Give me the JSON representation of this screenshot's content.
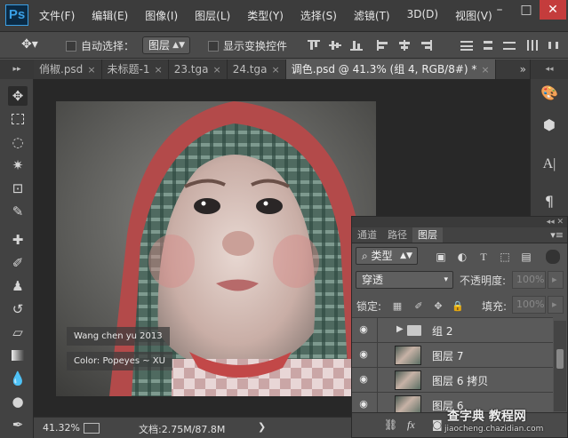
{
  "app": {
    "logo": "Ps"
  },
  "menu": [
    "文件(F)",
    "编辑(E)",
    "图像(I)",
    "图层(L)",
    "类型(Y)",
    "选择(S)",
    "滤镜(T)",
    "3D(D)",
    "视图(V)"
  ],
  "window_controls": [
    "–",
    "□",
    "✕"
  ],
  "options": {
    "auto_select_label": "自动选择：",
    "auto_select_value": "图层",
    "show_transform_label": "显示变换控件"
  },
  "tabs": [
    {
      "label": "俏椒.psd",
      "close": "×",
      "active": false
    },
    {
      "label": "未标题-1",
      "close": "×",
      "active": false
    },
    {
      "label": "23.tga",
      "close": "×",
      "active": false
    },
    {
      "label": "24.tga",
      "close": "×",
      "active": false
    },
    {
      "label": "调色.psd @ 41.3% (组 4, RGB/8#) *",
      "close": "×",
      "active": true
    }
  ],
  "tabs_more": "»",
  "canvas": {
    "watermark_line1": "Wang chen yu 2013",
    "watermark_line2": "Color: Popeyes ~ XU"
  },
  "status": {
    "zoom": "41.32%",
    "doc": "文档:2.75M/87.8M",
    "more": "❯"
  },
  "layers_panel": {
    "tabs": [
      "通道",
      "路径",
      "图层"
    ],
    "active_tab": "图层",
    "filter_kind": "类型",
    "blend_mode": "穿透",
    "opacity_label": "不透明度:",
    "opacity_value": "100%",
    "lock_label": "锁定:",
    "fill_label": "填充:",
    "fill_value": "100%",
    "layers": [
      {
        "name": "组 2",
        "type": "group"
      },
      {
        "name": "图层 7",
        "type": "layer"
      },
      {
        "name": "图层 6 拷贝",
        "type": "layer"
      },
      {
        "name": "图层 6",
        "type": "layer"
      }
    ]
  },
  "site_watermark": {
    "title": "查字典 教程网",
    "url": "jiaocheng.chazidian.com"
  },
  "colors": {
    "accent_logo": "#3aa0e6",
    "close_btn": "#c43c3c",
    "ui_dark": "#3c3c3c",
    "panel": "#535353"
  }
}
